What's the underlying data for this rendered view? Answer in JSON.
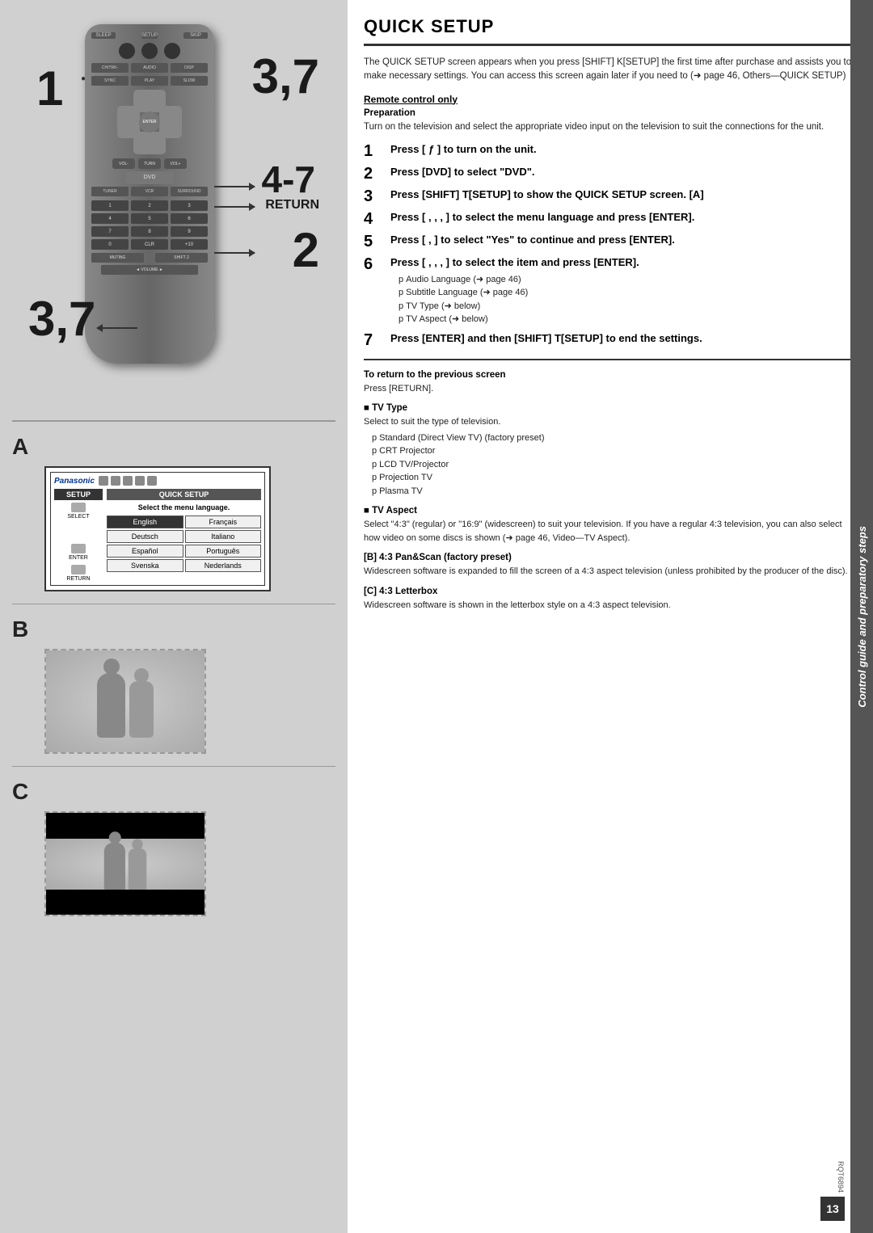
{
  "page": {
    "title": "QUICK SETUP",
    "page_number": "13",
    "catalog_number": "RQT6894"
  },
  "left_panel": {
    "label_1": "1",
    "label_37_top": "3,7",
    "label_47": "4-7",
    "label_return": "RETURN",
    "label_2": "2",
    "label_37_bottom": "3,7",
    "section_a_label": "A",
    "section_b_label": "B",
    "section_c_label": "C"
  },
  "setup_screen": {
    "brand": "Panasonic",
    "tab_label": "SETUP",
    "quick_tab_label": "QUICK SETUP",
    "select_text": "Select the menu language.",
    "languages": [
      {
        "name": "English",
        "selected": true
      },
      {
        "name": "Français",
        "selected": false
      },
      {
        "name": "Deutsch",
        "selected": false
      },
      {
        "name": "Italiano",
        "selected": false
      },
      {
        "name": "Español",
        "selected": false
      },
      {
        "name": "Português",
        "selected": false
      },
      {
        "name": "Svenska",
        "selected": false
      },
      {
        "name": "Nederlands",
        "selected": false
      }
    ],
    "bottom_labels": [
      "SELECT",
      "ENTER",
      "RETURN"
    ]
  },
  "right_panel": {
    "intro": "The QUICK SETUP screen appears when you press [SHIFT] K[SETUP] the first time after purchase and assists you to make necessary settings. You can access this screen again later if you need to (➜ page 46, Others—QUICK SETUP)",
    "remote_control_only_label": "Remote control only",
    "preparation_label": "Preparation",
    "preparation_text": "Turn on the television and select the appropriate video input on the television to suit the connections for the unit.",
    "steps": [
      {
        "num": "1",
        "text": "Press [ ƒ ] to turn on the unit."
      },
      {
        "num": "2",
        "text": "Press [DVD] to select \"DVD\"."
      },
      {
        "num": "3",
        "text": "Press [SHIFT] T[SETUP] to show the QUICK SETUP screen. [A]"
      },
      {
        "num": "4",
        "text": "Press [ ,  ,  ,   ] to select the menu language and press [ENTER]."
      },
      {
        "num": "5",
        "text": "Press [  ,   ] to select \"Yes\" to continue and press [ENTER]."
      },
      {
        "num": "6",
        "text": "Press [  ,  ,  ,   ] to select the item and press [ENTER].",
        "bullets": [
          "pAudio Language (➜ page 46)",
          "pSubtitle Language (➜ page 46)",
          "pTV Type (➜ below)",
          "pTV Aspect (➜ below)"
        ]
      },
      {
        "num": "7",
        "text": "Press [ENTER] and then [SHIFT] T[SETUP] to end the settings."
      }
    ],
    "to_return_label": "To return to the previous screen",
    "to_return_text": "Press [RETURN].",
    "tv_type_label": "■ TV Type",
    "tv_type_intro": "Select to suit the type of television.",
    "tv_type_bullets": [
      "Standard (Direct View TV) (factory preset)",
      "CRT Projector",
      "LCD TV/Projector",
      "Projection TV",
      "Plasma TV"
    ],
    "tv_aspect_label": "■ TV Aspect",
    "tv_aspect_intro": "Select \"4:3\" (regular) or \"16:9\" (widescreen) to suit your television. If you have a regular 4:3 television, you can also select how video on some discs is shown (➜ page 46, Video—TV Aspect).",
    "b_label": "[B]  4:3 Pan&Scan (factory preset)",
    "b_text": "Widescreen software is expanded to fill the screen of a 4:3 aspect television (unless prohibited by the producer of the disc).",
    "c_label": "[C]  4:3 Letterbox",
    "c_text": "Widescreen software is shown in the letterbox style on a 4:3 aspect television.",
    "vertical_text": "Control guide and preparatory steps"
  }
}
